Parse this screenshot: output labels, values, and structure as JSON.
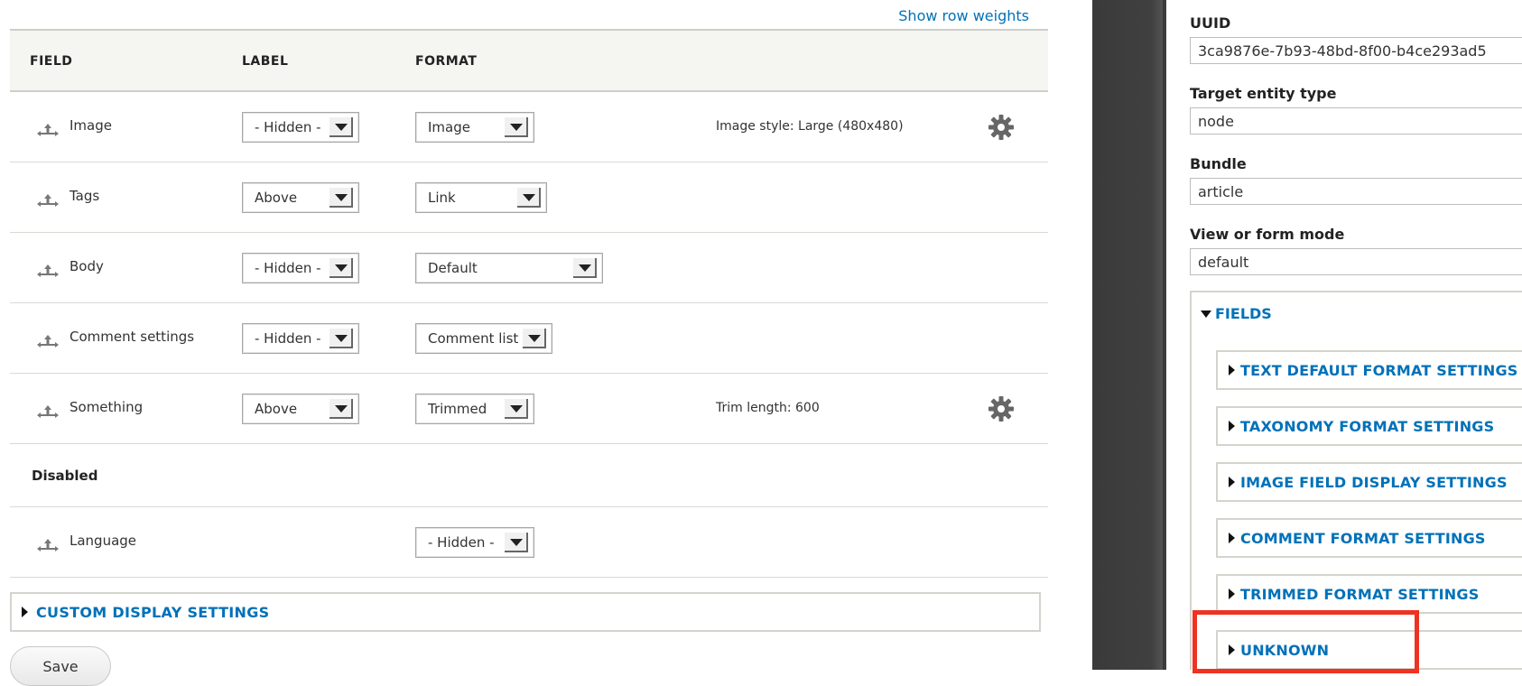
{
  "toolbar": {
    "row_weights_link": "Show row weights"
  },
  "table": {
    "headers": {
      "field": "FIELD",
      "label": "LABEL",
      "format": "FORMAT"
    },
    "rows": [
      {
        "field": "Image",
        "label": "- Hidden -",
        "format": "Image",
        "summary": "Image style: Large (480x480)",
        "has_gear": true
      },
      {
        "field": "Tags",
        "label": "Above",
        "format": "Link",
        "summary": "",
        "has_gear": false
      },
      {
        "field": "Body",
        "label": "- Hidden -",
        "format": "Default",
        "summary": "",
        "has_gear": false
      },
      {
        "field": "Comment settings",
        "label": "- Hidden -",
        "format": "Comment list",
        "summary": "",
        "has_gear": false
      },
      {
        "field": "Something",
        "label": "Above",
        "format": "Trimmed",
        "summary": "Trim length: 600",
        "has_gear": true
      }
    ],
    "disabled_section": "Disabled",
    "disabled_rows": [
      {
        "field": "Language",
        "format": "- Hidden -"
      }
    ]
  },
  "custom_display": {
    "label": "CUSTOM DISPLAY SETTINGS"
  },
  "save_button": "Save",
  "config": {
    "uuid_label": "UUID",
    "uuid_value": "3ca9876e-7b93-48bd-8f00-b4ce293ad5",
    "target_type_label": "Target entity type",
    "target_type_value": "node",
    "bundle_label": "Bundle",
    "bundle_value": "article",
    "mode_label": "View or form mode",
    "mode_value": "default",
    "fields_label": "FIELDS",
    "sections": [
      "TEXT DEFAULT FORMAT SETTINGS",
      "TAXONOMY FORMAT SETTINGS",
      "IMAGE FIELD DISPLAY SETTINGS",
      "COMMENT FORMAT SETTINGS",
      "TRIMMED FORMAT SETTINGS",
      "UNKNOWN"
    ]
  },
  "colors": {
    "link": "#0071b8",
    "highlight": "#ee3322",
    "header_bg": "#f5f5f2"
  }
}
